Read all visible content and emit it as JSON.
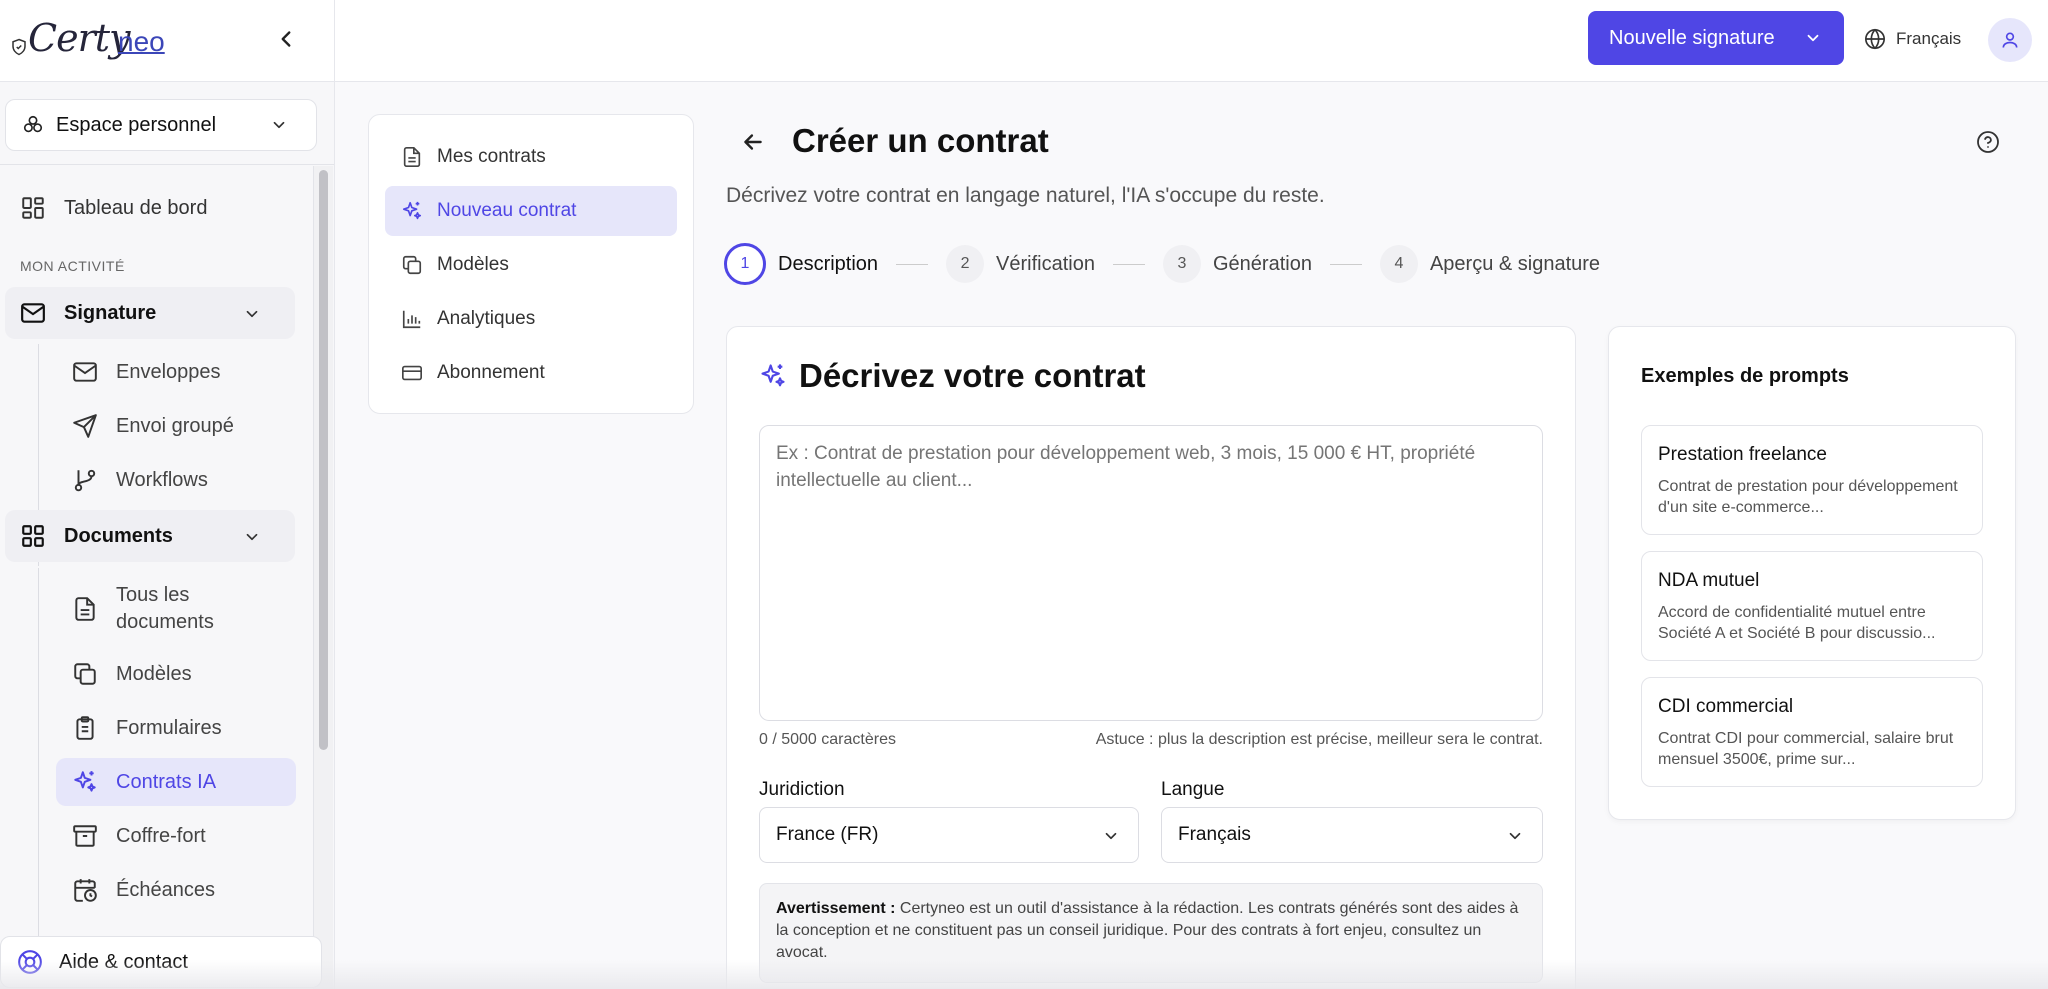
{
  "brand": {
    "logo_text_script": "Certy",
    "logo_text_accent": "neo"
  },
  "header": {
    "new_signature_label": "Nouvelle signature",
    "language_label": "Français"
  },
  "sidebar": {
    "workspace_label": "Espace personnel",
    "dashboard_label": "Tableau de bord",
    "section_label": "MON ACTIVITÉ",
    "signature_group": {
      "label": "Signature",
      "items": [
        {
          "label": "Enveloppes",
          "icon": "mail-icon"
        },
        {
          "label": "Envoi groupé",
          "icon": "send-icon"
        },
        {
          "label": "Workflows",
          "icon": "git-branch-icon"
        }
      ]
    },
    "documents_group": {
      "label": "Documents",
      "items": [
        {
          "label": "Tous les documents",
          "icon": "file-text-icon"
        },
        {
          "label": "Modèles",
          "icon": "copy-icon"
        },
        {
          "label": "Formulaires",
          "icon": "clipboard-icon"
        },
        {
          "label": "Contrats IA",
          "icon": "sparkles-icon",
          "active": true
        },
        {
          "label": "Coffre-fort",
          "icon": "archive-icon"
        },
        {
          "label": "Échéances",
          "icon": "calendar-clock-icon"
        }
      ]
    },
    "help_label": "Aide & contact"
  },
  "contracts_menu": {
    "items": [
      {
        "label": "Mes contrats",
        "icon": "file-text-icon"
      },
      {
        "label": "Nouveau contrat",
        "icon": "sparkles-icon",
        "active": true
      },
      {
        "label": "Modèles",
        "icon": "copy-icon"
      },
      {
        "label": "Analytiques",
        "icon": "bar-chart-icon"
      },
      {
        "label": "Abonnement",
        "icon": "credit-card-icon"
      }
    ]
  },
  "main": {
    "title": "Créer un contrat",
    "subtitle": "Décrivez votre contrat en langage naturel, l'IA s'occupe du reste.",
    "steps": [
      {
        "num": "1",
        "label": "Description",
        "active": true
      },
      {
        "num": "2",
        "label": "Vérification"
      },
      {
        "num": "3",
        "label": "Génération"
      },
      {
        "num": "4",
        "label": "Aperçu & signature"
      }
    ],
    "card_title": "Décrivez votre contrat",
    "textarea_placeholder": "Ex : Contrat de prestation pour développement web, 3 mois, 15 000 € HT, propriété intellectuelle au client...",
    "char_count": "0 / 5000 caractères",
    "tip": "Astuce : plus la description est précise, meilleur sera le contrat.",
    "jurisdiction_label": "Juridiction",
    "jurisdiction_value": "France (FR)",
    "language_label": "Langue",
    "language_value": "Français",
    "warning_strong": "Avertissement :",
    "warning_text": " Certyneo est un outil d'assistance à la rédaction. Les contrats générés sont des aides à la conception et ne constituent pas un conseil juridique. Pour des contrats à fort enjeu, consultez un avocat."
  },
  "examples": {
    "title": "Exemples de prompts",
    "items": [
      {
        "title": "Prestation freelance",
        "desc": "Contrat de prestation pour développement d'un site e-commerce..."
      },
      {
        "title": "NDA mutuel",
        "desc": "Accord de confidentialité mutuel entre Société A et Société B pour discussio..."
      },
      {
        "title": "CDI commercial",
        "desc": "Contrat CDI pour commercial, salaire brut mensuel 3500€, prime sur..."
      }
    ]
  },
  "colors": {
    "accent": "#4f46e5",
    "accent_soft": "#e6e6fa"
  }
}
